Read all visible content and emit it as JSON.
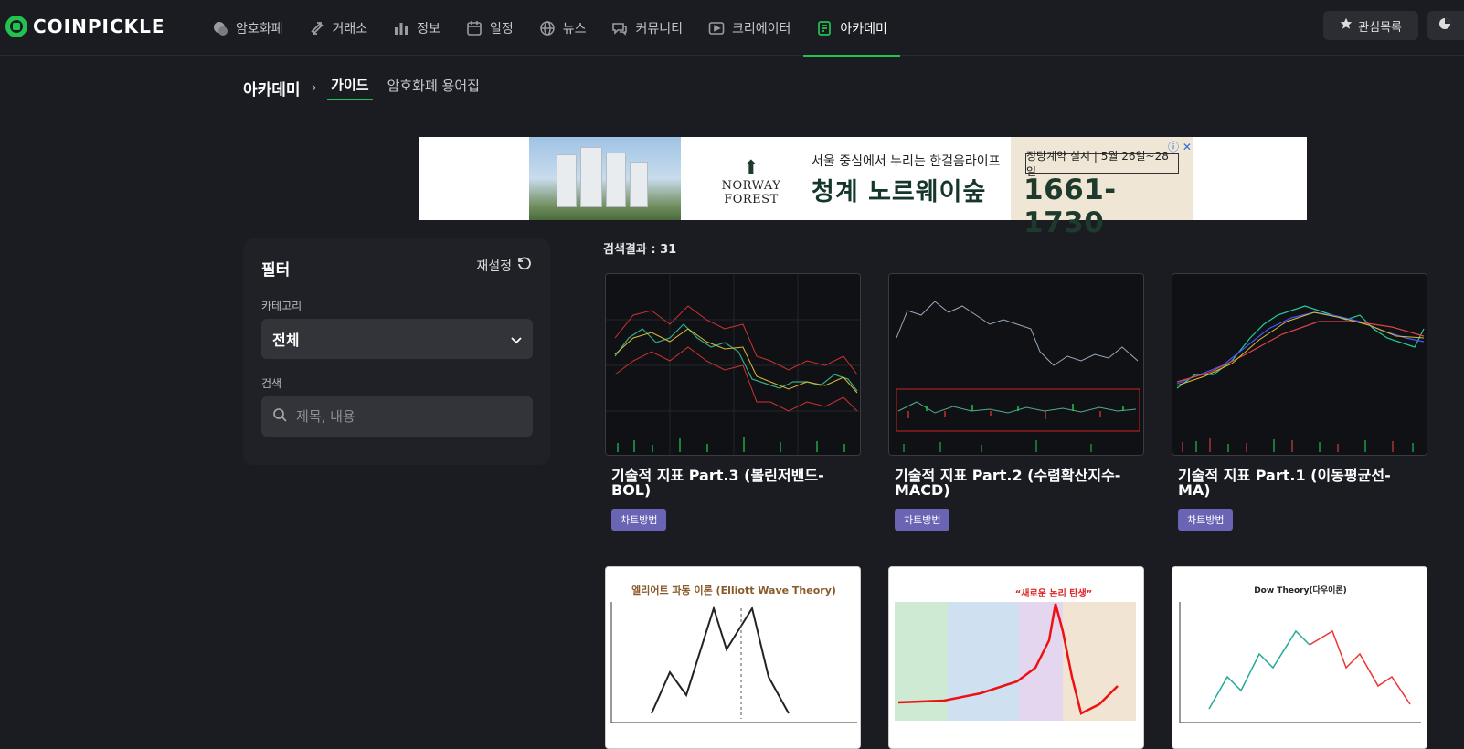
{
  "header": {
    "logo_text": "COINPICKLE",
    "nav": [
      {
        "label": "암호화폐",
        "icon": "coins-icon"
      },
      {
        "label": "거래소",
        "icon": "exchange-icon"
      },
      {
        "label": "정보",
        "icon": "bar-chart-icon"
      },
      {
        "label": "일정",
        "icon": "calendar-icon"
      },
      {
        "label": "뉴스",
        "icon": "globe-icon"
      },
      {
        "label": "커뮤니티",
        "icon": "chat-icon"
      },
      {
        "label": "크리에이터",
        "icon": "play-icon"
      },
      {
        "label": "아카데미",
        "icon": "book-icon",
        "active": true
      }
    ],
    "watchlist_label": "관심목록"
  },
  "breadcrumb": {
    "root": "아카데미",
    "tabs": [
      {
        "label": "가이드",
        "active": true
      },
      {
        "label": "암호화폐 용어집"
      }
    ]
  },
  "ad": {
    "brand": "NORWAY FOREST",
    "line1": "서울 중심에서 누리는 한걸음라이프",
    "line2": "청계 노르웨이숲",
    "badge": "정당계약 실시 | 5월 26일~28일",
    "phone": "1661-1730"
  },
  "filter": {
    "title": "필터",
    "reset_label": "재설정",
    "category_label": "카테고리",
    "category_value": "전체",
    "search_label": "검색",
    "search_placeholder": "제목, 내용"
  },
  "results": {
    "label": "검색결과 : 31",
    "cards": [
      {
        "title": "기술적 지표 Part.3 (볼린저밴드-BOL)",
        "tag": "차트방법"
      },
      {
        "title": "기술적 지표 Part.2 (수렴확산지수-MACD)",
        "tag": "차트방법"
      },
      {
        "title": "기술적 지표 Part.1 (이동평균선-MA)",
        "tag": "차트방법"
      },
      {
        "thumb_title": "엘리어트 파동 이론 (Elliott Wave Theory)"
      },
      {
        "thumb_title": "“새로운 논리 탄생”"
      },
      {
        "thumb_title": "Dow Theory(다우이론)"
      }
    ]
  },
  "colors": {
    "accent": "#21c24f",
    "tag": "#6a64b5",
    "background": "#1b1c21"
  }
}
